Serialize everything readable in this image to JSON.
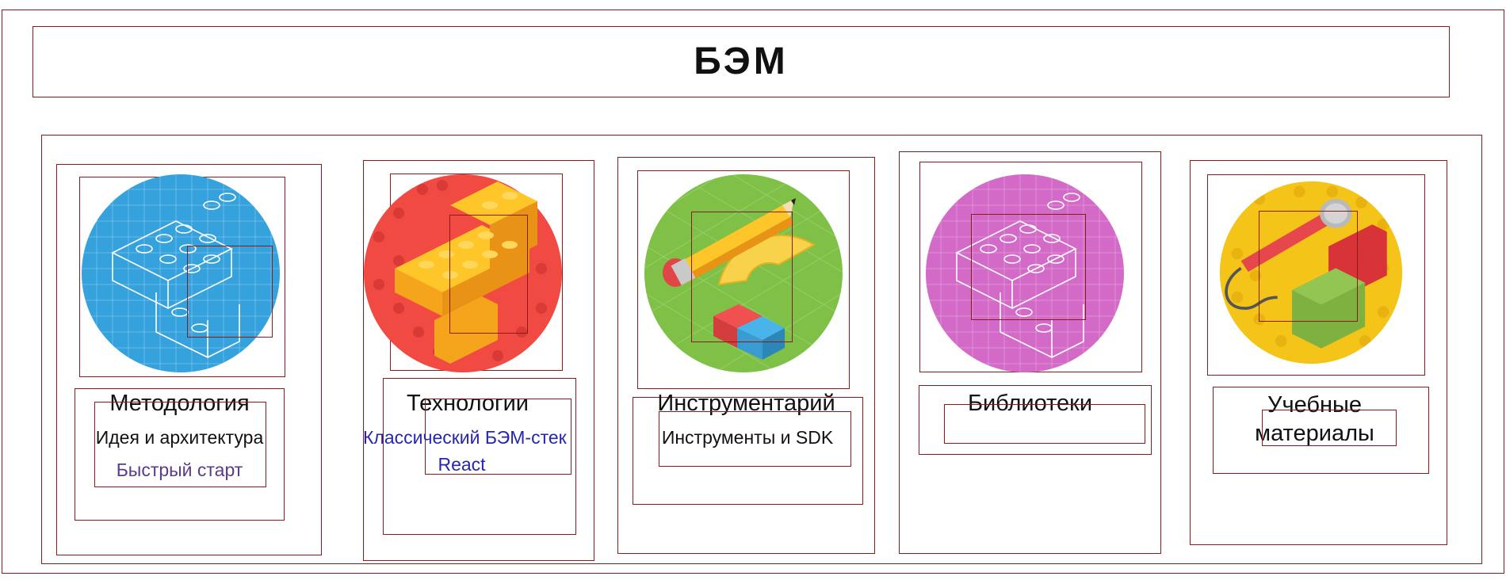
{
  "header": {
    "title": "БЭМ"
  },
  "sections": [
    {
      "heading": "Методология",
      "items": [
        "Идея и архитектура",
        "Быстрый старт"
      ],
      "color": "#36a2dd",
      "icon": "lego-blueprint-icon"
    },
    {
      "heading": "Технологии",
      "items": [
        "Классический БЭМ-стек",
        "React"
      ],
      "color": "#f04a43",
      "icon": "lego-bricks-icon"
    },
    {
      "heading": "Инструментарий",
      "items": [
        "Инструменты и SDK"
      ],
      "color": "#7ec146",
      "icon": "pencil-protractor-icon"
    },
    {
      "heading": "Библиотеки",
      "items": [],
      "color": "#d46ac7",
      "icon": "lego-blueprint-icon"
    },
    {
      "heading": "Учебные материалы",
      "heading_lines": [
        "Учебные",
        "материалы"
      ],
      "items": [],
      "color": "#f5c418",
      "icon": "microphone-bricks-icon"
    }
  ]
}
